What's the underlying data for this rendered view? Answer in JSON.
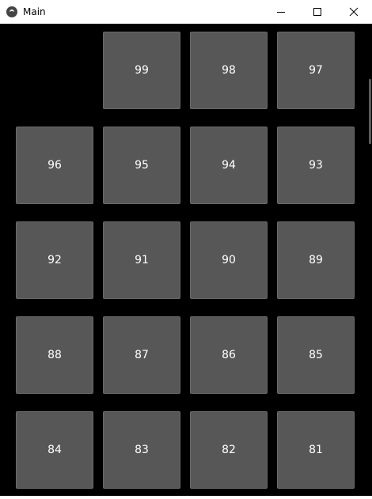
{
  "window": {
    "title": "Main"
  },
  "tiles": [
    "99",
    "98",
    "97",
    "96",
    "95",
    "94",
    "93",
    "92",
    "91",
    "90",
    "89",
    "88",
    "87",
    "86",
    "85",
    "84",
    "83",
    "82",
    "81"
  ],
  "colors": {
    "background": "#000000",
    "tile": "#575757",
    "tile_text": "#ffffff"
  },
  "icons": {
    "app": "app-logo-icon",
    "minimize": "minimize-icon",
    "maximize": "maximize-icon",
    "close": "close-icon"
  }
}
